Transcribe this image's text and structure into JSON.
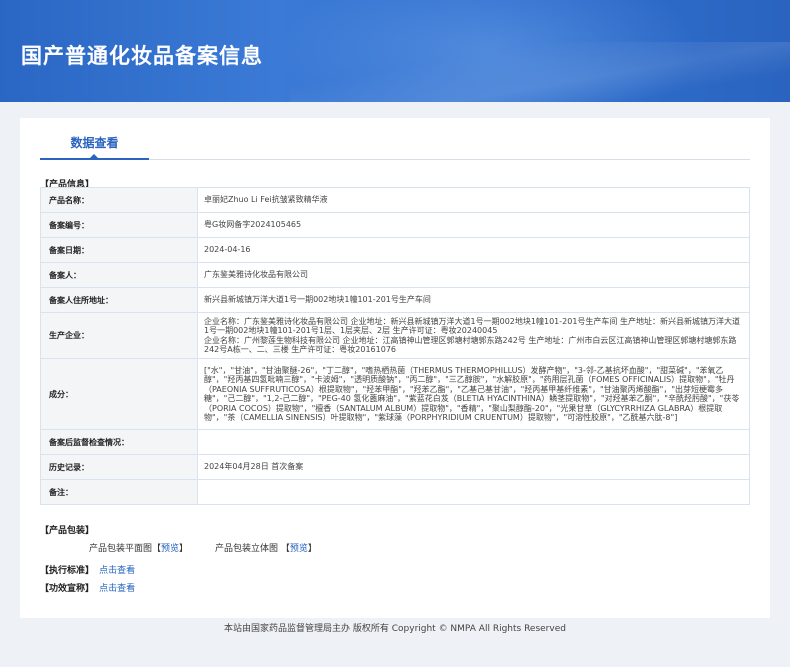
{
  "header": {
    "title": "国产普通化妆品备案信息"
  },
  "tab": {
    "label": "数据查看"
  },
  "sections": {
    "product_info": "【产品信息】",
    "packaging": "【产品包装】",
    "standard": "【执行标准】",
    "efficacy": "【功效宣称】"
  },
  "info": {
    "rows": [
      {
        "key": "产品名称：",
        "value": "卓丽妃Zhuo Li Fei抗皱紧致精华液"
      },
      {
        "key": "备案编号：",
        "value": "粤G妆网备字2024105465"
      },
      {
        "key": "备案日期：",
        "value": "2024-04-16"
      },
      {
        "key": "备案人：",
        "value": "广东鉴美雅诗化妆品有限公司"
      },
      {
        "key": "备案人住所地址：",
        "value": "新兴县新城镇万洋大道1号一期002地块1幢101-201号生产车间"
      },
      {
        "key": "生产企业：",
        "value": "企业名称：广东鉴美雅诗化妆品有限公司 企业地址：新兴县新城镇万洋大道1号一期002地块1幢101-201号生产车间 生产地址：新兴县新城镇万洋大道1号一期002地块1幢101-201号1层、1层夹层、2层 生产许可证：粤妆20240045\n企业名称：广州黎莲生物科技有限公司 企业地址：江高镇神山管理区郭塘村塘郭东路242号 生产地址：广州市白云区江高镇神山管理区郭塘村塘郭东路242号A栋一、二、三楼 生产许可证：粤妆20161076"
      },
      {
        "key": "成分：",
        "value": "[\"水\"，\"甘油\"，\"甘油聚醚-26\"，\"丁二醇\"，\"嗜热栖热菌（THERMUS THERMOPHILLUS）发酵产物\"，\"3-邻-乙基抗坏血酸\"，\"甜菜碱\"，\"苯氧乙醇\"，\"羟丙基四氢吡喃三醇\"，\"卡波姆\"，\"透明质酸钠\"，\"丙二醇\"，\"三乙醇胺\"，\"水解胶原\"，\"药用层孔菌（FOMES OFFICINALIS）提取物\"，\"牡丹（PAEONIA SUFFRUTICOSA）根提取物\"，\"羟苯甲酯\"，\"羟苯乙酯\"，\"乙基己基甘油\"，\"羟丙基甲基纤维素\"，\"甘油聚丙烯酸酯\"，\"出芽短梗霉多糖\"，\"己二醇\"，\"1,2-己二醇\"，\"PEG-40 氢化蓖麻油\"，\"紫蓝花白芨（BLETIA HYACINTHINA）鳞茎提取物\"，\"对羟基苯乙酮\"，\"辛酰羟肟酸\"，\"茯苓（PORIA COCOS）提取物\"，\"檀香（SANTALUM ALBUM）提取物\"，\"香精\"，\"聚山梨醇酯-20\"，\"光果甘草（GLYCYRRHIZA GLABRA）根提取物\"，\"茶（CAMELLIA SINENSIS）叶提取物\"，\"紫球藻（PORPHYRIDIUM CRUENTUM）提取物\"，\"可溶性胶原\"，\"乙酰基六肽-8\"]"
      },
      {
        "key": "备案后监督检查情况：",
        "value": ""
      },
      {
        "key": "历史记录：",
        "value": "2024年04月28日 首次备案"
      },
      {
        "key": "备注：",
        "value": ""
      }
    ]
  },
  "packaging": {
    "flat_label": "产品包装平面图",
    "solid_label": "产品包装立体图",
    "bracket_open": "【",
    "bracket_close": "】",
    "preview_link": "预览"
  },
  "links": {
    "view": "点击查看"
  },
  "footer": {
    "text": "本站由国家药品监督管理局主办 版权所有 Copyright © NMPA All Rights Reserved"
  }
}
